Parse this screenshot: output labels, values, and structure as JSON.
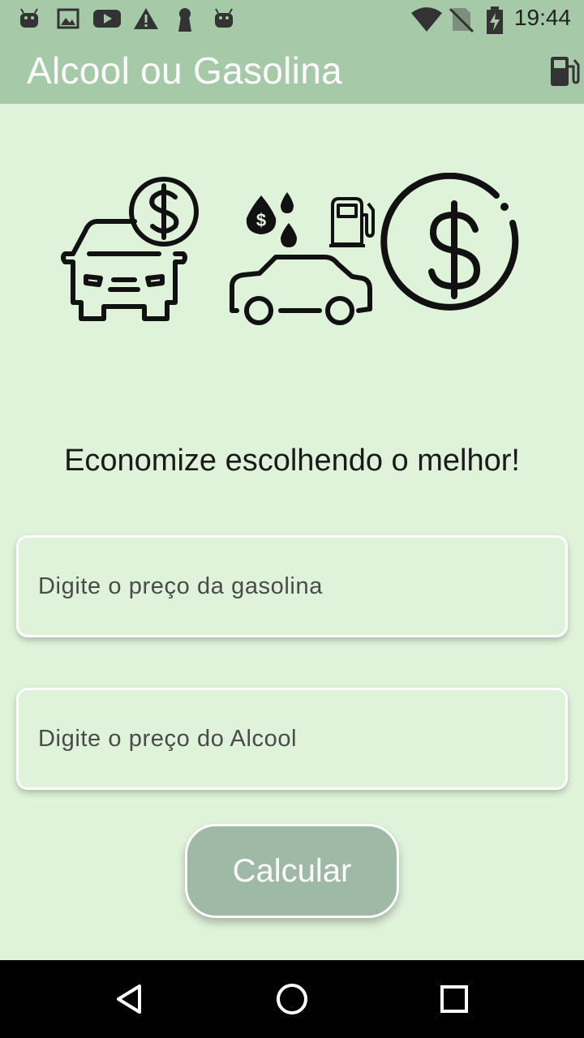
{
  "status_bar": {
    "time": "19:44",
    "icons": [
      "android-icon",
      "image-icon",
      "youtube-icon",
      "warning-icon",
      "keyhole-icon",
      "android-icon",
      "wifi-icon",
      "no-sim-icon",
      "battery-charging-icon"
    ]
  },
  "app_bar": {
    "title": "Alcool ou Gasolina",
    "action_icon": "gas-station-icon",
    "color": "#a6c9a8"
  },
  "main": {
    "background": "#dff3da",
    "illustration_icons": [
      "car-dollar-icon",
      "car-fuel-drops-icon",
      "fuel-pump-icon",
      "dollar-circle-icon"
    ],
    "tagline": "Economize escolhendo o melhor!",
    "gas_field": {
      "placeholder": "Digite o preço da gasolina",
      "value": ""
    },
    "alcohol_field": {
      "placeholder": "Digite o preço do Alcool",
      "value": ""
    },
    "calculate_label": "Calcular",
    "button_color": "#9fb9a7"
  },
  "nav_bar": {
    "icons": [
      "back-icon",
      "home-icon",
      "recents-icon"
    ]
  }
}
